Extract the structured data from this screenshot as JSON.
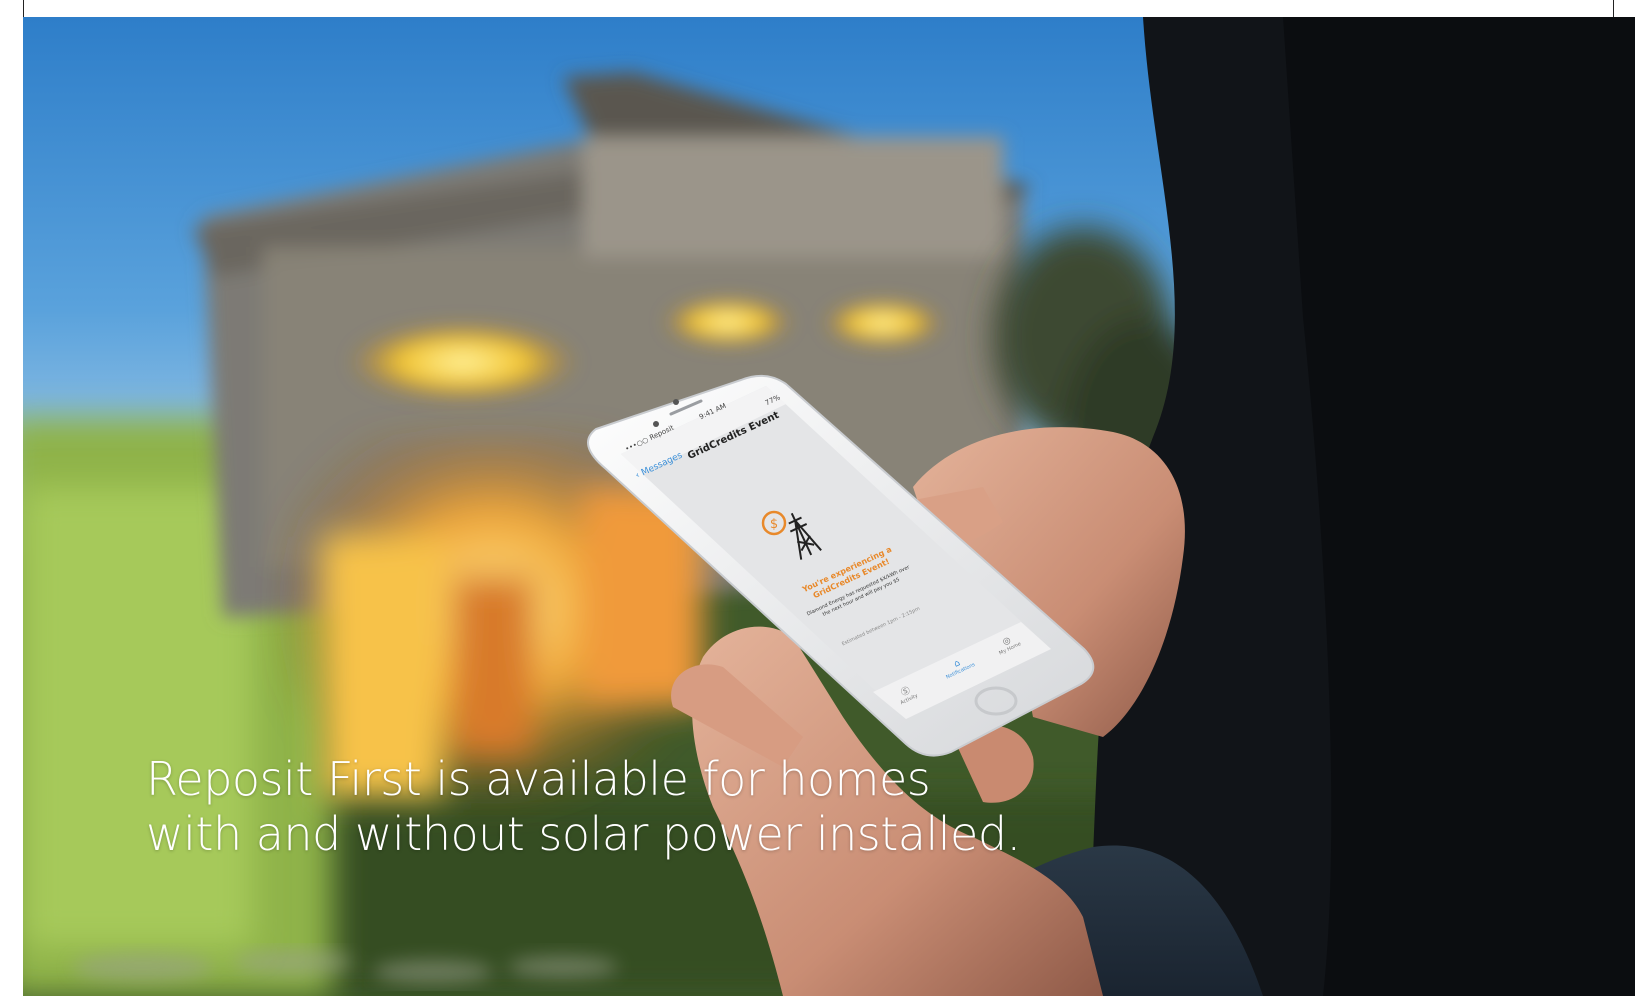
{
  "caption": {
    "line1": "Reposit First is available for homes",
    "line2": "with and without solar power installed."
  },
  "phone": {
    "status_carrier": "•••○○ Reposit",
    "status_time": "9:41 AM",
    "status_battery": "77%",
    "nav_back": "Messages",
    "nav_title": "GridCredits Event",
    "event_headline_1": "You're experiencing a",
    "event_headline_2": "GridCredits Event!",
    "event_body_1": "Diamond Energy has requested $X/kWh over",
    "event_body_2": "the next hour and will pay you $5",
    "event_estimate": "Estimated between 1pm - 2:15pm",
    "tabs": [
      "Activity",
      "Notifications",
      "My Home"
    ]
  },
  "colors": {
    "accent_orange": "#e8892b",
    "ios_blue": "#3a8fd8",
    "sky": "#3a86d2",
    "window_glow": "#f5d23a"
  },
  "icons": {
    "event_icon": "dollar-pylon-icon",
    "tab_activity": "dollar-circle-icon",
    "tab_notifications": "bell-icon",
    "tab_home": "person-circle-icon"
  }
}
